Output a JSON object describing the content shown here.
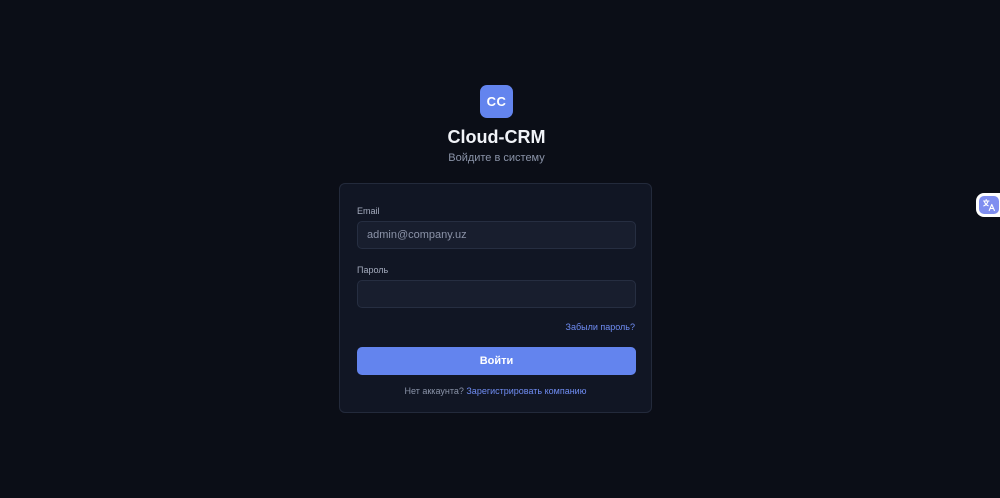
{
  "brand": {
    "logo_text": "CC",
    "title": "Cloud-CRM",
    "subtitle": "Войдите в систему"
  },
  "form": {
    "email_label": "Email",
    "email_placeholder": "admin@company.uz",
    "email_value": "",
    "password_label": "Пароль",
    "password_value": "",
    "forgot_link": "Забыли пароль?",
    "submit_label": "Войти",
    "no_account_text": "Нет аккаунта?",
    "register_link": "Зарегистрировать компанию"
  },
  "widgets": {
    "translate_icon": "translate-icon"
  },
  "colors": {
    "background": "#0b0e17",
    "card": "#111624",
    "accent": "#6384ee",
    "link": "#6f8cf2"
  }
}
